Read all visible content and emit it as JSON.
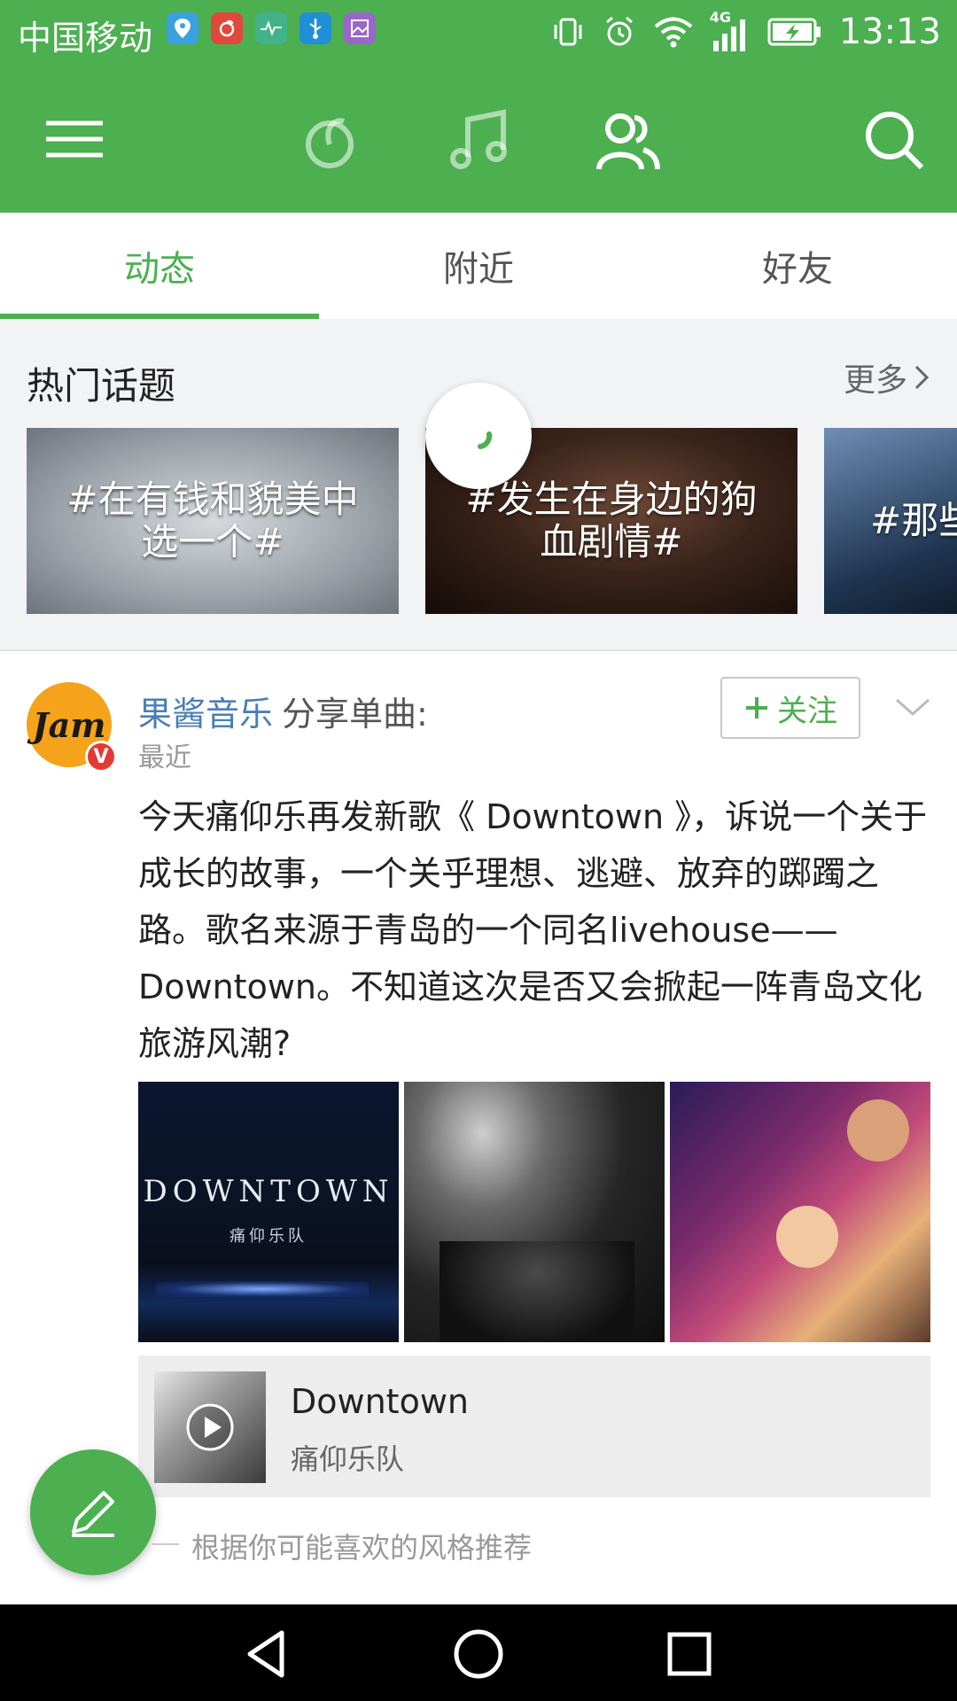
{
  "status_bar": {
    "carrier": "中国移动",
    "network": "4G",
    "time": "13:13"
  },
  "tabs": [
    {
      "label": "动态",
      "active": true
    },
    {
      "label": "附近",
      "active": false
    },
    {
      "label": "好友",
      "active": false
    }
  ],
  "hot_topics": {
    "title": "热门话题",
    "more_label": "更多",
    "cards": [
      {
        "text": "#在有钱和貌美中选一个#"
      },
      {
        "text": "#发生在身边的狗血剧情#"
      },
      {
        "text": "#那些以上"
      }
    ]
  },
  "post": {
    "username": "果酱音乐",
    "action": "分享单曲:",
    "time": "最近",
    "avatar_text": "Jam",
    "verified_badge": "V",
    "follow_label": "关注",
    "text": "今天痛仰乐再发新歌《 Downtown 》，诉说一个关于成长的故事，一个关乎理想、逃避、放弃的踯躅之路。歌名来源于青岛的一个同名livehouse——Downtown。不知道这次是否又会掀起一阵青岛文化旅游风潮?",
    "photos": [
      {
        "caption": "DOWNTOWN",
        "subcaption": "痛仰乐队"
      },
      {
        "caption": ""
      },
      {
        "caption": ""
      }
    ],
    "song": {
      "title": "Downtown",
      "artist": "痛仰乐队"
    }
  },
  "recommend_label": "根据你可能喜欢的风格推荐",
  "colors": {
    "brand_green": "#4caf50",
    "link_blue": "#4a7fb5"
  }
}
